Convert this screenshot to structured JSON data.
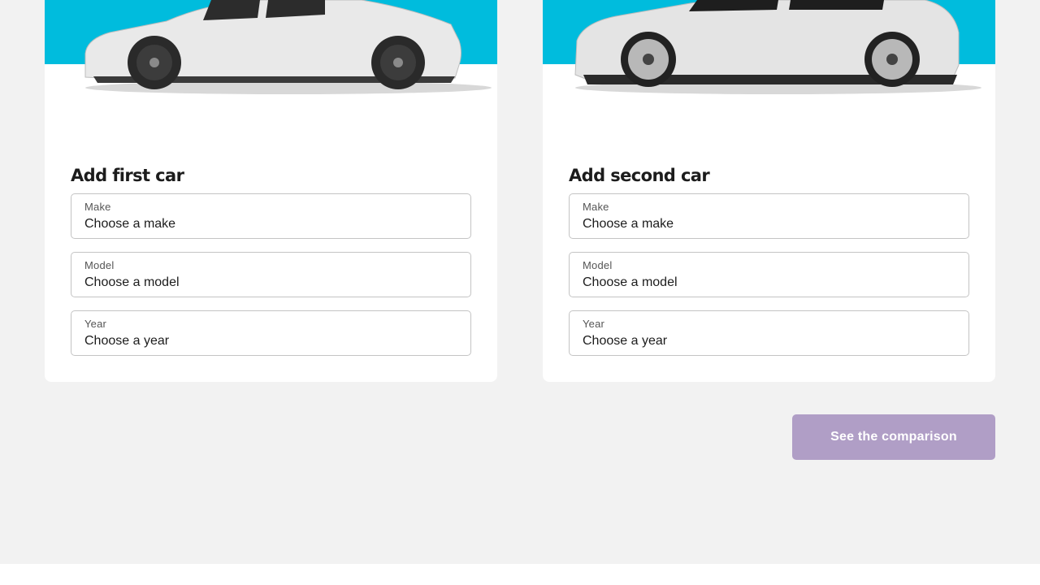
{
  "first_car": {
    "title": "Add first car",
    "image": "tesla-model-y-white-side-view",
    "make": {
      "label": "Make",
      "value": "Choose a make"
    },
    "model": {
      "label": "Model",
      "value": "Choose a model"
    },
    "year": {
      "label": "Year",
      "value": "Choose a year"
    }
  },
  "second_car": {
    "title": "Add second car",
    "image": "silver-suv-side-view",
    "make": {
      "label": "Make",
      "value": "Choose a make"
    },
    "model": {
      "label": "Model",
      "value": "Choose a model"
    },
    "year": {
      "label": "Year",
      "value": "Choose a year"
    }
  },
  "actions": {
    "compare_label": "See the comparison"
  },
  "colors": {
    "banner": "#00bcdd",
    "page_background": "#f2f2f2",
    "card_background": "#ffffff",
    "button_disabled": "#b09ec6",
    "field_border": "#c4c4c4",
    "text": "#1c1c1c"
  }
}
